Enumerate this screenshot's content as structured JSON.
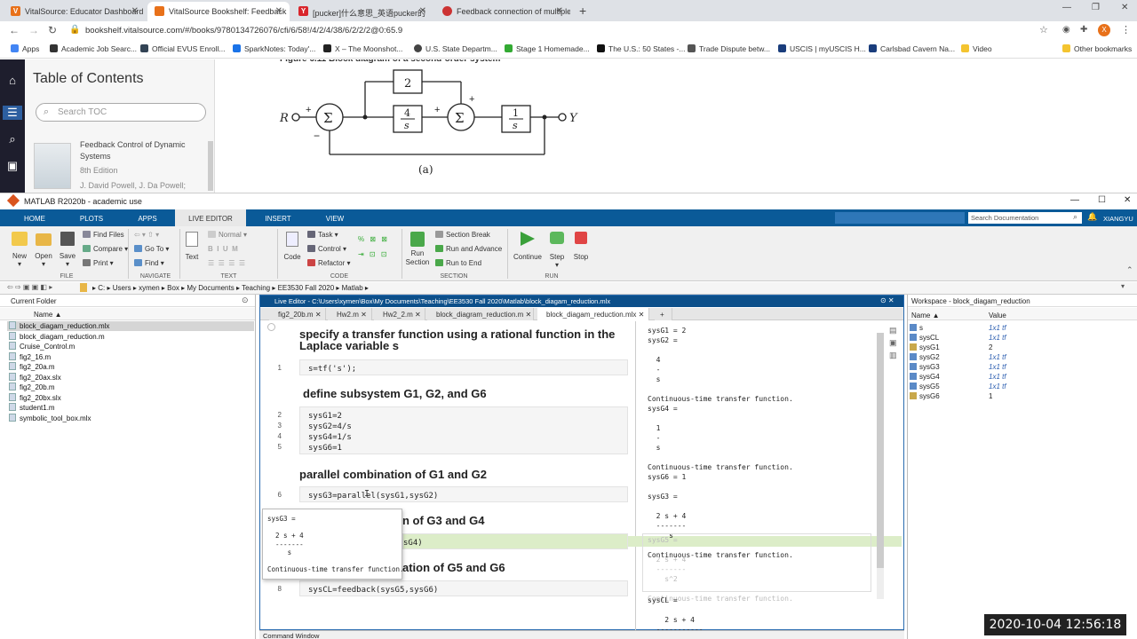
{
  "browser": {
    "tabs": [
      {
        "label": "VitalSource: Educator Dashboard",
        "fav": "V",
        "color": "#e8711a"
      },
      {
        "label": "VitalSource Bookshelf: Feedback",
        "fav": "",
        "color": "#e8711a"
      },
      {
        "label": "[pucker]什么意思_英语pucker的",
        "fav": "Y",
        "color": "#d9262c"
      },
      {
        "label": "Feedback connection of multiple",
        "fav": "",
        "color": "#d9262c"
      }
    ],
    "url": "bookshelf.vitalsource.com/#/books/9780134726076/cfi/6/58!/4/2/4/38/6/2/2/2@0:65.9",
    "avatar": "X",
    "bookmarks": [
      "Apps",
      "Academic Job Searc...",
      "Official EVUS Enroll...",
      "SparkNotes: Today'...",
      "X – The Moonshot...",
      "U.S. State Departm...",
      "Stage 1 Homemade...",
      "The U.S.: 50 States -...",
      "Trade Dispute betw...",
      "USCIS | myUSCIS H...",
      "Carlsbad Cavern Na...",
      "Video",
      "Other bookmarks"
    ]
  },
  "vitalsource": {
    "toc_title": "Table of Contents",
    "search_placeholder": "Search TOC",
    "book_title": "Feedback Control of Dynamic Systems",
    "edition": "8th Edition",
    "authors": "J. David Powell, J. Da Powell;",
    "figure_caption": "Figure 6.11 Block diagram of a second-order system",
    "diagram": {
      "r": "R",
      "y": "Y",
      "g1": "2",
      "g2_num": "4",
      "g2_den": "s",
      "g4_num": "1",
      "g4_den": "s",
      "sum": "Σ",
      "plus": "+",
      "minus": "−",
      "label": "(a)"
    }
  },
  "matlab": {
    "window_title": "MATLAB R2020b - academic use",
    "tabs": [
      "HOME",
      "PLOTS",
      "APPS",
      "LIVE EDITOR",
      "INSERT",
      "VIEW"
    ],
    "search_placeholder": "Search Documentation",
    "user": "XIANGYU",
    "file_group": {
      "new": "New",
      "open": "Open",
      "save": "Save",
      "find_files": "Find Files",
      "compare": "Compare",
      "print": "Print",
      "label": "FILE"
    },
    "navigate_group": {
      "go_to": "Go To",
      "find": "Find",
      "label": "NAVIGATE"
    },
    "text_group": {
      "text": "Text",
      "style": "Normal",
      "label": "TEXT"
    },
    "code_group": {
      "code": "Code",
      "task": "Task",
      "control": "Control",
      "refactor": "Refactor",
      "label": "CODE"
    },
    "section_group": {
      "run_section": "Run Section",
      "section_break": "Section Break",
      "run_and_advance": "Run and Advance",
      "run_to_end": "Run to End",
      "label": "SECTION"
    },
    "run_group": {
      "continue": "Continue",
      "step": "Step",
      "stop": "Stop",
      "label": "RUN"
    },
    "path": [
      "C:",
      "Users",
      "xymen",
      "Box",
      "My Documents",
      "Teaching",
      "EE3530 Fall 2020",
      "Matlab"
    ],
    "current_folder": {
      "title": "Current Folder",
      "col_name": "Name ▲",
      "files": [
        "block_diagam_reduction.mlx",
        "block_diagam_reduction.m",
        "Cruise_Control.m",
        "fig2_16.m",
        "fig2_20a.m",
        "fig2_20ax.slx",
        "fig2_20b.m",
        "fig2_20bx.slx",
        "student1.m",
        "symbolic_tool_box.mlx"
      ]
    },
    "editor": {
      "title": "Live Editor - C:\\Users\\xymen\\Box\\My Documents\\Teaching\\EE3530 Fall 2020\\Matlab\\block_diagam_reduction.mlx",
      "tabs": [
        "fig2_20b.m",
        "Hw2.m",
        "Hw2_2.m",
        "block_diagram_reduction.m",
        "block_diagam_reduction.mlx"
      ],
      "sections": [
        {
          "head": "specify a transfer function using a rational function in the Laplace variable s",
          "lines": [
            "1"
          ],
          "code": "s=tf('s');"
        },
        {
          "head": "define subsystem G1, G2, and G6",
          "lines": [
            "2",
            "3",
            "4",
            "5"
          ],
          "code": "sysG1=2\nsysG2=4/s\nsysG4=1/s\nsysG6=1"
        },
        {
          "head": "parallel combination of G1 and G2",
          "lines": [
            "6"
          ],
          "code": "sysG3=parallel(sysG1,sysG2)"
        },
        {
          "head": "n of G3 and G4",
          "lines": [
            "7"
          ],
          "code": "sG4)"
        },
        {
          "head": "ation of G5 and G6",
          "lines": [
            "8"
          ],
          "code": "sysCL=feedback(sysG5,sysG6)"
        }
      ],
      "tooltip": "sysG3 =\n\n  2 s + 4\n  -------\n     s\n\nContinuous-time transfer function.",
      "output": "sysG1 = 2\nsysG2 =\n\n  4\n  -\n  s\n\nContinuous-time transfer function.\nsysG4 =\n\n  1\n  -\n  s\n\nContinuous-time transfer function.\nsysG6 = 1\n\nsysG3 =\n\n  2 s + 4\n  -------\n     s\n\nContinuous-time transfer function.",
      "output_faded": "sysG5 =\n\n  2 s + 4\n  -------\n    s^2\n\nContinuous-time transfer function.",
      "output_tail": "sysCL =\n\n    2 s + 4\n  -----------"
    },
    "workspace": {
      "title": "Workspace - block_diagam_reduction",
      "col_name": "Name ▲",
      "col_value": "Value",
      "vars": [
        {
          "name": "s",
          "value": "1x1 tf"
        },
        {
          "name": "sysCL",
          "value": "1x1 tf"
        },
        {
          "name": "sysG1",
          "value": "2"
        },
        {
          "name": "sysG2",
          "value": "1x1 tf"
        },
        {
          "name": "sysG3",
          "value": "1x1 tf"
        },
        {
          "name": "sysG4",
          "value": "1x1 tf"
        },
        {
          "name": "sysG5",
          "value": "1x1 tf"
        },
        {
          "name": "sysG6",
          "value": "1"
        }
      ]
    },
    "command_window": "Command Window"
  },
  "timestamp": "2020-10-04  12:56:18"
}
